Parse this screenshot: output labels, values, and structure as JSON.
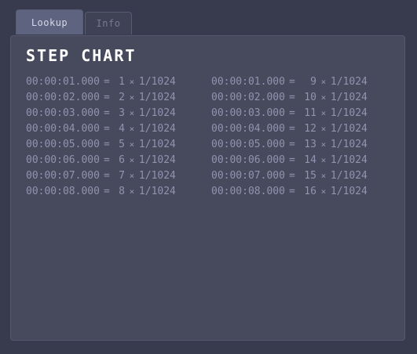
{
  "tabs": [
    {
      "label": "Lookup",
      "active": true
    },
    {
      "label": "Info",
      "active": false
    }
  ],
  "panel": {
    "title": "STEP CHART"
  },
  "symbols": {
    "equals": "=",
    "times": "×"
  },
  "rows": [
    {
      "left": {
        "time": "00:00:01.000",
        "n": "1",
        "frac": "1/1024"
      },
      "right": {
        "time": "00:00:01.000",
        "n": "9",
        "frac": "1/1024"
      }
    },
    {
      "left": {
        "time": "00:00:02.000",
        "n": "2",
        "frac": "1/1024"
      },
      "right": {
        "time": "00:00:02.000",
        "n": "10",
        "frac": "1/1024"
      }
    },
    {
      "left": {
        "time": "00:00:03.000",
        "n": "3",
        "frac": "1/1024"
      },
      "right": {
        "time": "00:00:03.000",
        "n": "11",
        "frac": "1/1024"
      }
    },
    {
      "left": {
        "time": "00:00:04.000",
        "n": "4",
        "frac": "1/1024"
      },
      "right": {
        "time": "00:00:04.000",
        "n": "12",
        "frac": "1/1024"
      }
    },
    {
      "left": {
        "time": "00:00:05.000",
        "n": "5",
        "frac": "1/1024"
      },
      "right": {
        "time": "00:00:05.000",
        "n": "13",
        "frac": "1/1024"
      }
    },
    {
      "left": {
        "time": "00:00:06.000",
        "n": "6",
        "frac": "1/1024"
      },
      "right": {
        "time": "00:00:06.000",
        "n": "14",
        "frac": "1/1024"
      }
    },
    {
      "left": {
        "time": "00:00:07.000",
        "n": "7",
        "frac": "1/1024"
      },
      "right": {
        "time": "00:00:07.000",
        "n": "15",
        "frac": "1/1024"
      }
    },
    {
      "left": {
        "time": "00:00:08.000",
        "n": "8",
        "frac": "1/1024"
      },
      "right": {
        "time": "00:00:08.000",
        "n": "16",
        "frac": "1/1024"
      }
    }
  ]
}
